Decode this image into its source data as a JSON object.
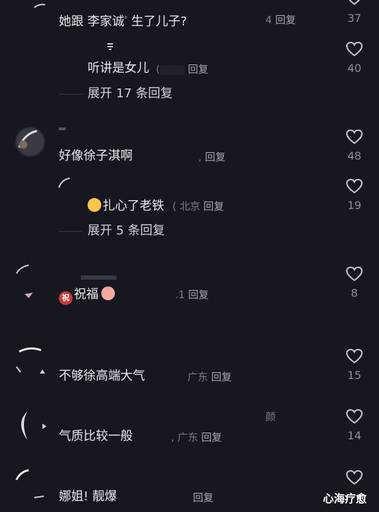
{
  "comments": [
    {
      "id": "c1",
      "text_prefix": "她跟",
      "mention": "李家诚",
      "text_suffix": "生了儿子?",
      "meta_tail": "4",
      "reply_label": "回复",
      "likes": "37"
    },
    {
      "id": "c1r1",
      "text": "听讲是女儿",
      "meta_tail": "(",
      "reply_label": "回复",
      "likes": "40"
    },
    {
      "id": "c1expand",
      "expand_label": "展开 17 条回复"
    },
    {
      "id": "c2",
      "text": "好像徐子淇啊",
      "meta_tail": ",",
      "reply_label": "回复",
      "likes": "48"
    },
    {
      "id": "c2r1",
      "text": "扎心了老铁",
      "meta_tail": "( 北京",
      "reply_label": "回复",
      "likes": "19"
    },
    {
      "id": "c2expand",
      "expand_label": "展开 5 条回复"
    },
    {
      "id": "c3",
      "emoji_badge": "祝",
      "text": "祝福",
      "meta_tail": ".1",
      "reply_label": "回复",
      "likes": "8"
    },
    {
      "id": "c4",
      "text": "不够徐高端大气",
      "meta_tail": "广东",
      "reply_label": "回复",
      "likes": "15"
    },
    {
      "id": "c5",
      "header_fragment": "颜",
      "text": "气质比较一般",
      "meta_tail": ", 广东",
      "reply_label": "回复",
      "likes": "14"
    },
    {
      "id": "c6",
      "text": "娜姐! 靓爆",
      "meta_tail": "",
      "reply_label": "回复",
      "likes": ""
    }
  ],
  "watermark": "心海疗愈",
  "colors": {
    "background": "#17171f",
    "text_primary": "#e9e9ee",
    "text_meta": "#7c7c86"
  },
  "icons": {
    "like": "heart-outline-icon"
  }
}
